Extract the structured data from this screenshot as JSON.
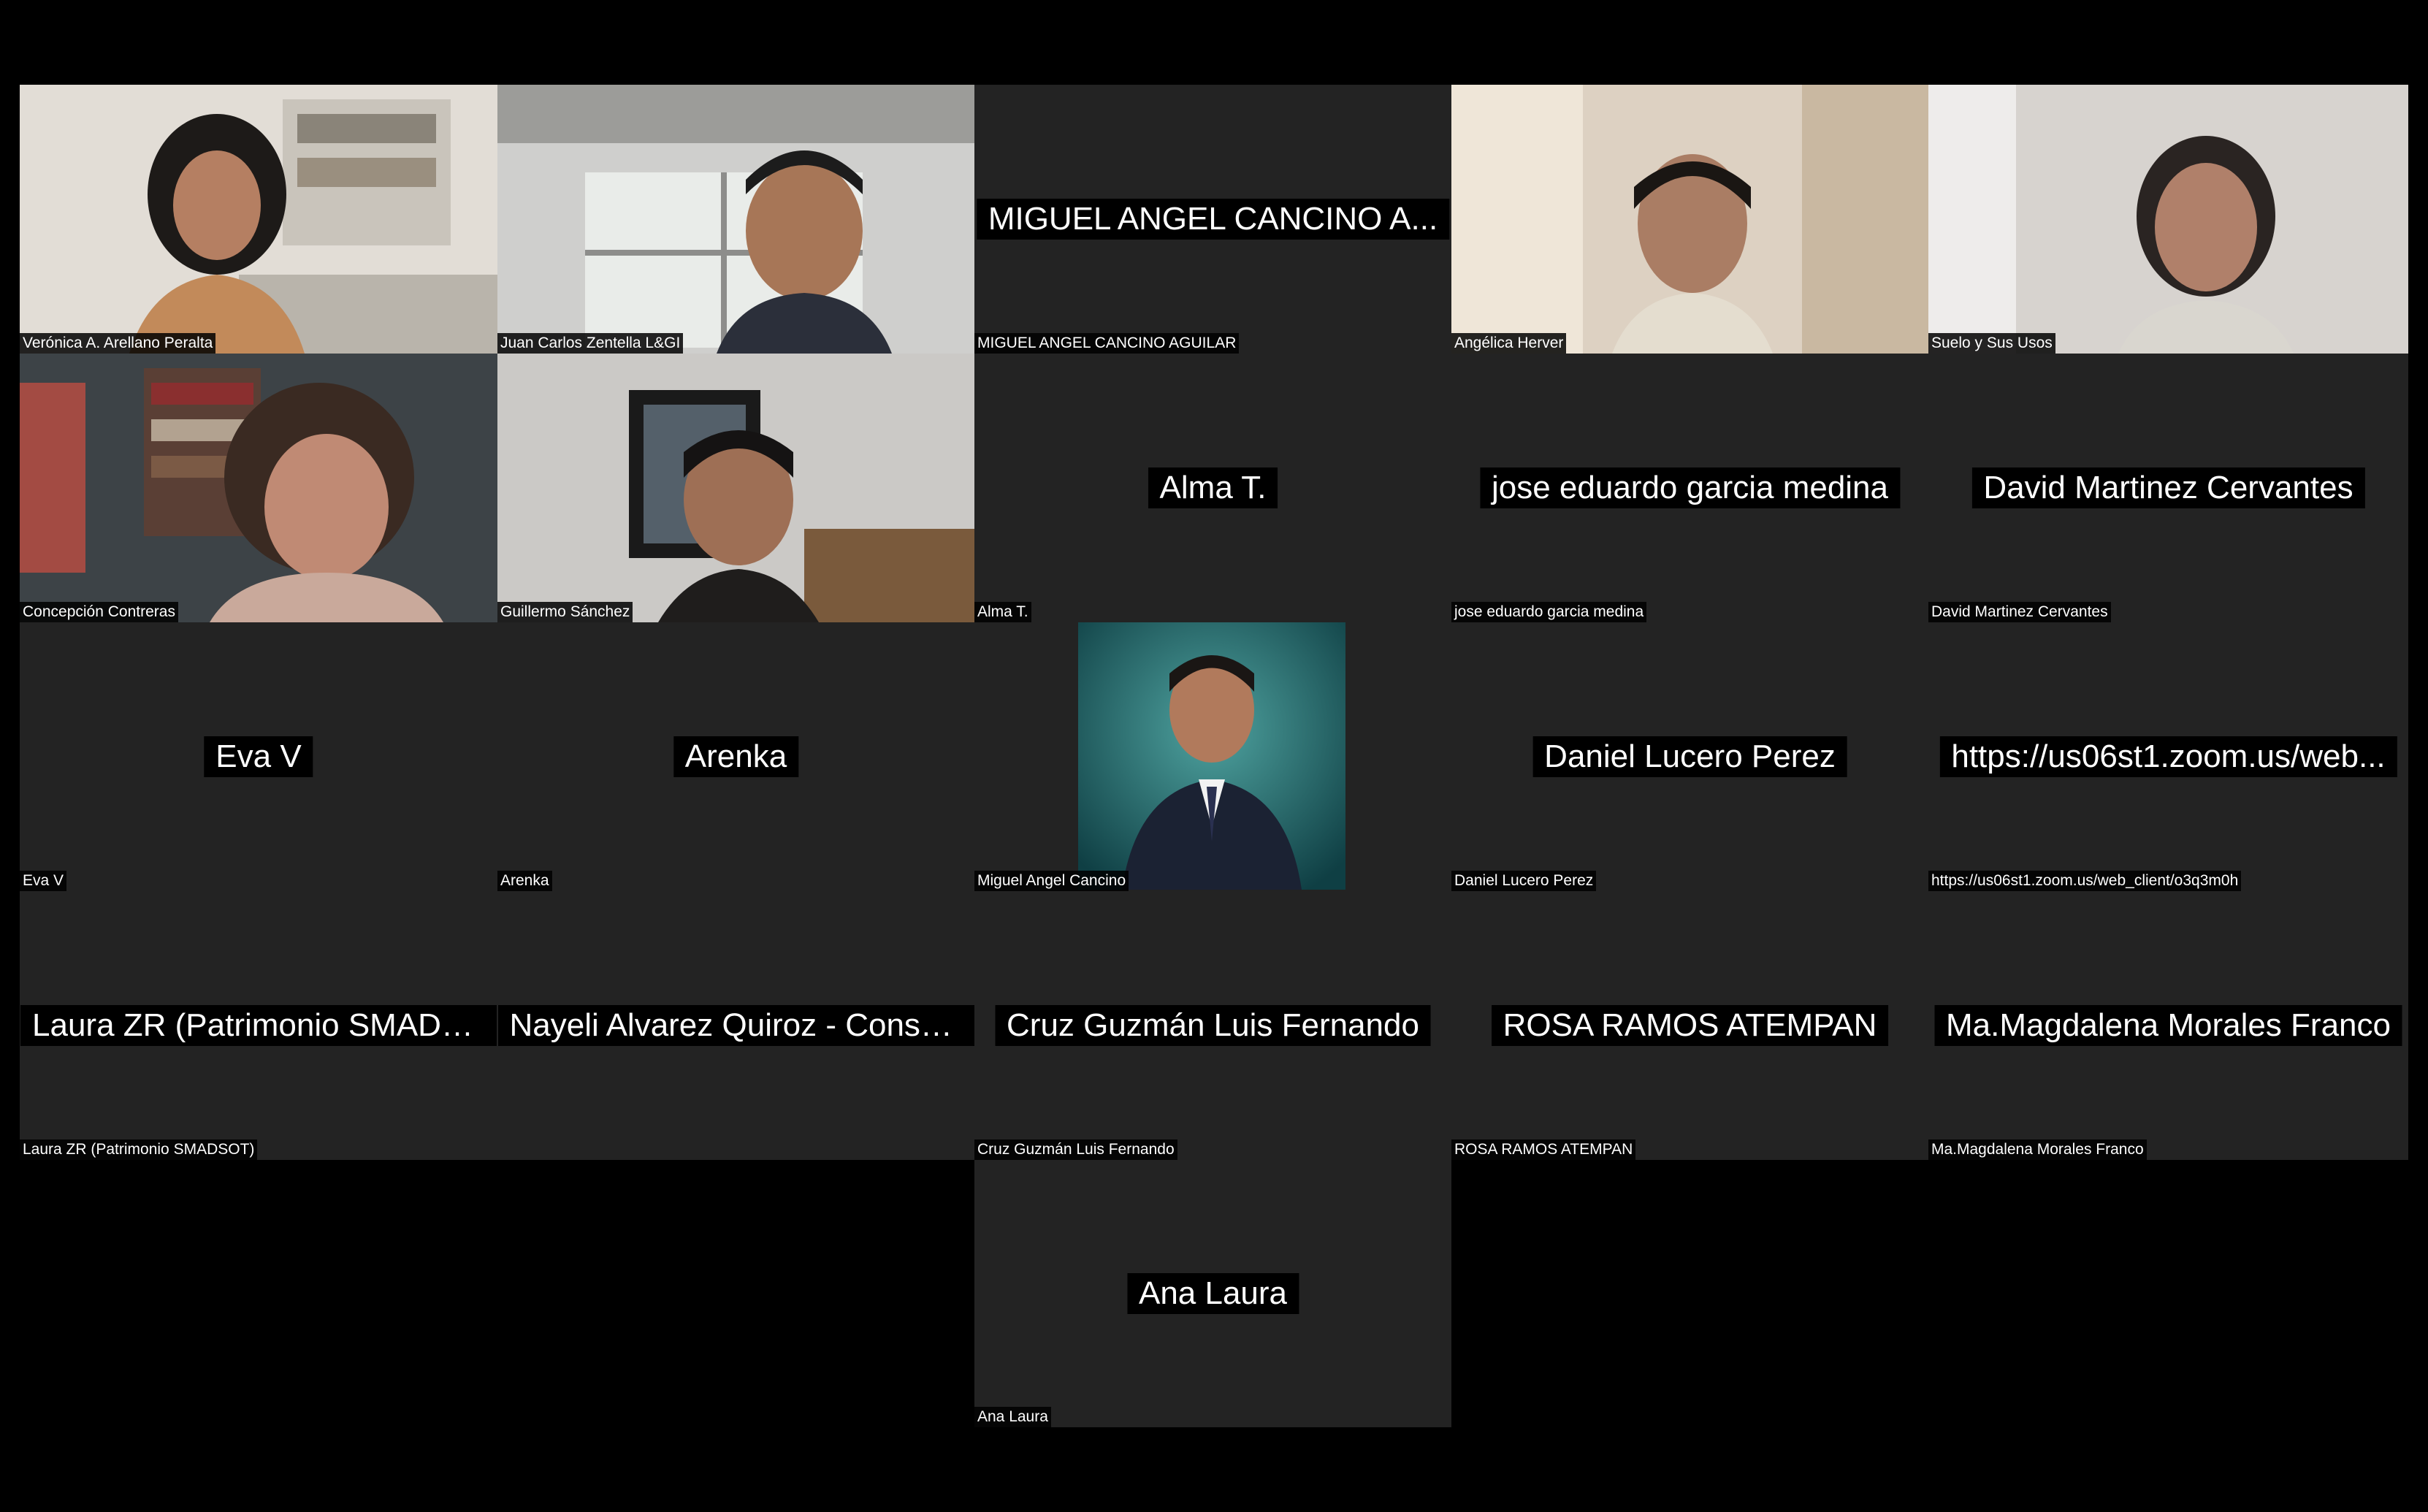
{
  "window": {
    "background": "#000000",
    "tile_color": "#232323"
  },
  "participants": [
    {
      "id": "p1",
      "label": "Verónica A. Arellano Peralta",
      "video": true
    },
    {
      "id": "p2",
      "label": "Juan Carlos Zentella L&GI",
      "video": true
    },
    {
      "id": "p3",
      "display": "MIGUEL ANGEL CANCINO A...",
      "label": "MIGUEL ANGEL CANCINO AGUILAR",
      "video": false
    },
    {
      "id": "p4",
      "label": "Angélica Herver",
      "video": true
    },
    {
      "id": "p5",
      "label": "Suelo y Sus Usos",
      "video": true
    },
    {
      "id": "p6",
      "label": "Concepción Contreras",
      "video": true
    },
    {
      "id": "p7",
      "label": "Guillermo Sánchez",
      "video": true
    },
    {
      "id": "p8",
      "display": "Alma T.",
      "label": "Alma T.",
      "video": false
    },
    {
      "id": "p9",
      "display": "jose eduardo garcia medina",
      "label": "jose eduardo garcia medina",
      "video": false
    },
    {
      "id": "p10",
      "display": "David Martinez Cervantes",
      "label": "David Martinez Cervantes",
      "video": false
    },
    {
      "id": "p11",
      "display": "Eva V",
      "label": "Eva V",
      "video": false
    },
    {
      "id": "p12",
      "display": "Arenka",
      "label": "Arenka",
      "video": false
    },
    {
      "id": "p13",
      "label": "Miguel Angel Cancino",
      "video": false,
      "avatar": true
    },
    {
      "id": "p14",
      "display": "Daniel Lucero Perez",
      "label": "Daniel Lucero Perez",
      "video": false
    },
    {
      "id": "p15",
      "display": "https://us06st1.zoom.us/web...",
      "label": "https://us06st1.zoom.us/web_client/o3q3m0h",
      "video": false
    },
    {
      "id": "p16",
      "display": "Laura ZR (Patrimonio SMADS...",
      "label": "Laura ZR (Patrimonio SMADSOT)",
      "video": false
    },
    {
      "id": "p17",
      "display": "Nayeli Alvarez Quiroz - Conse...",
      "label": "",
      "video": false
    },
    {
      "id": "p18",
      "display": "Cruz Guzmán Luis Fernando",
      "label": "Cruz Guzmán Luis Fernando",
      "video": false
    },
    {
      "id": "p19",
      "display": "ROSA RAMOS ATEMPAN",
      "label": "ROSA RAMOS ATEMPAN",
      "video": false
    },
    {
      "id": "p20",
      "display": "Ma.Magdalena Morales Franco",
      "label": "Ma.Magdalena Morales Franco",
      "video": false
    },
    {
      "id": "p21",
      "display": "Ana Laura",
      "label": "Ana Laura",
      "video": false
    }
  ]
}
